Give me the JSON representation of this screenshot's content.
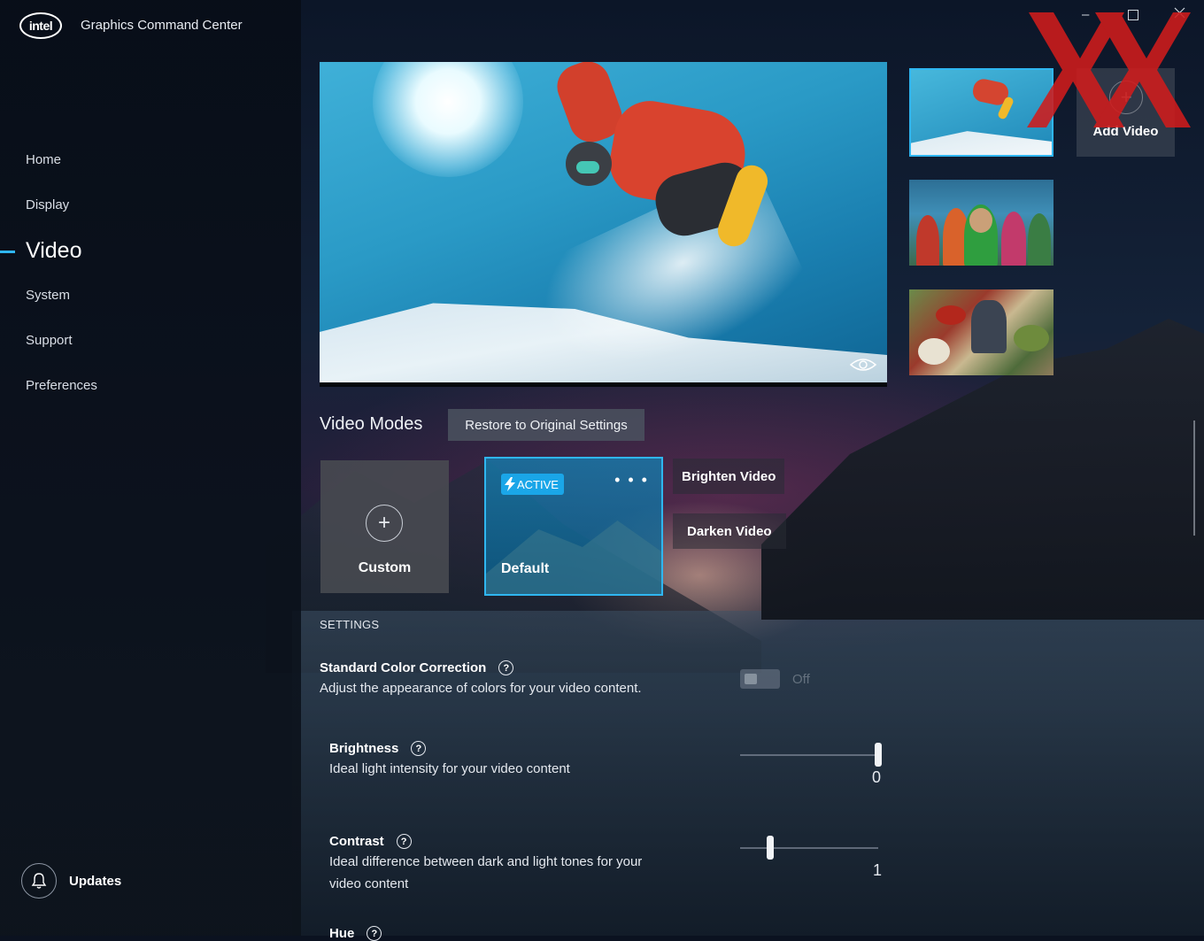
{
  "app": {
    "title": "Graphics Command Center",
    "logo_text": "intel"
  },
  "nav": {
    "items": [
      {
        "label": "Home"
      },
      {
        "label": "Display"
      },
      {
        "label": "Video"
      },
      {
        "label": "System"
      },
      {
        "label": "Support"
      },
      {
        "label": "Preferences"
      }
    ],
    "active": "Video"
  },
  "updates": {
    "label": "Updates"
  },
  "videos": {
    "add_label": "Add Video",
    "selected_index": 0
  },
  "video_modes": {
    "title": "Video Modes",
    "restore_label": "Restore to Original Settings",
    "custom_label": "Custom",
    "active_badge": "ACTIVE",
    "more_label": "• • •",
    "default_label": "Default",
    "brighten_label": "Brighten Video",
    "darken_label": "Darken Video"
  },
  "settings": {
    "section_label": "SETTINGS",
    "standard_color": {
      "title": "Standard Color Correction",
      "description": "Adjust the appearance of colors for your video content.",
      "toggle_state": "Off"
    },
    "brightness": {
      "title": "Brightness",
      "description": "Ideal light intensity for your video content",
      "value": "0",
      "level": 1.0
    },
    "contrast": {
      "title": "Contrast",
      "description_line1": "Ideal difference between dark and light tones for your",
      "description_line2": "video content",
      "value": "1",
      "level": 0.22
    },
    "hue": {
      "title": "Hue"
    }
  },
  "colors": {
    "accent": "#2fb6f0",
    "badge": "#1aa6e8",
    "watermark": "#d01c1c"
  }
}
